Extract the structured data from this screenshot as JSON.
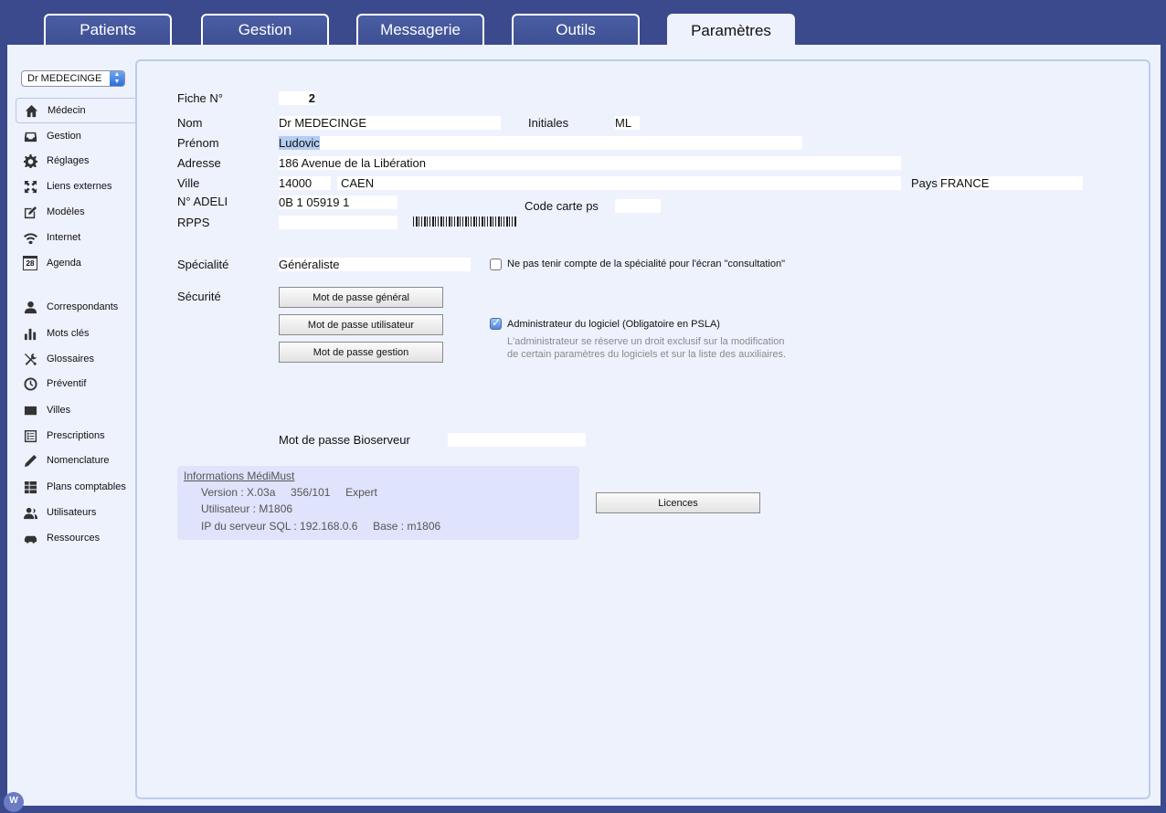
{
  "tabs": [
    "Patients",
    "Gestion",
    "Messagerie",
    "Outils",
    "Paramètres"
  ],
  "sidebar": {
    "doctor_select": "Dr MEDECINGE",
    "items": [
      {
        "label": "Médecin",
        "icon": "home-icon"
      },
      {
        "label": "Gestion",
        "icon": "inbox-icon"
      },
      {
        "label": "Réglages",
        "icon": "gear-icon"
      },
      {
        "label": "Liens externes",
        "icon": "expand-icon"
      },
      {
        "label": "Modèles",
        "icon": "edit-icon"
      },
      {
        "label": "Internet",
        "icon": "wifi-icon"
      },
      {
        "label": "Agenda",
        "icon": "calendar-icon",
        "badge": "28"
      },
      {
        "label": "Correspondants",
        "icon": "person-icon"
      },
      {
        "label": "Mots clés",
        "icon": "bar-chart-icon"
      },
      {
        "label": "Glossaires",
        "icon": "tools-icon"
      },
      {
        "label": "Préventif",
        "icon": "clock-icon"
      },
      {
        "label": "Villes",
        "icon": "envelope-icon"
      },
      {
        "label": "Prescriptions",
        "icon": "list-icon"
      },
      {
        "label": "Nomenclature",
        "icon": "pencil-icon"
      },
      {
        "label": "Plans comptables",
        "icon": "table-icon"
      },
      {
        "label": "Utilisateurs",
        "icon": "users-icon"
      },
      {
        "label": "Ressources",
        "icon": "car-icon"
      }
    ]
  },
  "form": {
    "fiche_label": "Fiche N°",
    "fiche_value": "2",
    "nom_label": "Nom",
    "nom_value": "Dr MEDECINGE",
    "initiales_label": "Initiales",
    "initiales_value": "ML",
    "prenom_label": "Prénom",
    "prenom_value": "Ludovic",
    "adresse_label": "Adresse",
    "adresse_value": "186 Avenue de la Libération",
    "ville_label": "Ville",
    "cp_value": "14000",
    "ville_value": "CAEN",
    "pays_label": "Pays",
    "pays_value": "FRANCE",
    "adeli_label": "N° ADELI",
    "adeli_value": "0B 1 05919 1",
    "code_carte_label": "Code carte ps",
    "code_carte_value": "",
    "rpps_label": "RPPS",
    "rpps_value": "",
    "specialite_label": "Spécialité",
    "specialite_value": "Généraliste",
    "specialite_checkbox_label": "Ne pas tenir compte de la spécialité pour l'écran \"consultation\"",
    "securite_label": "Sécurité",
    "btn_general": "Mot de passe général",
    "btn_utilisateur": "Mot de passe utilisateur",
    "btn_gestion": "Mot de passe gestion",
    "admin_checkbox_label": "Administrateur du logiciel (Obligatoire en PSLA)",
    "admin_note_1": "L'administrateur se réserve un droit exclusif sur la modification",
    "admin_note_2": "de certain paramètres du logiciels et sur la liste des auxiliaires.",
    "bioserveur_label": "Mot de passe Bioserveur",
    "bioserveur_value": ""
  },
  "info": {
    "title": "Informations MédiMust",
    "version": "Version : X.03a     356/101     Expert",
    "utilisateur": "Utilisateur : M1806",
    "ip": "IP du serveur SQL : 192.168.0.6     Base : m1806",
    "licences_button": "Licences"
  },
  "footer_logo": "W"
}
